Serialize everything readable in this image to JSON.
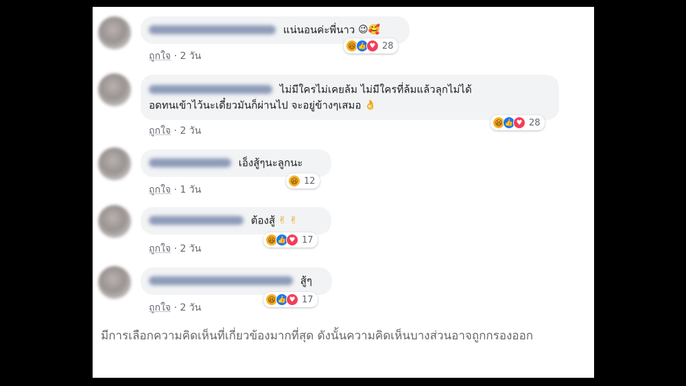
{
  "comments": [
    {
      "text": "แน่นอนค่ะพี่นาว",
      "emoji": "😉🥰",
      "like_label": "ถูกใจ",
      "dot": "·",
      "time": "2 วัน",
      "count": "28"
    },
    {
      "text": "ไม่มีใครไม่เคยล้ม ไม่มีใครที่ล้มแล้วลุกไม่ได้",
      "text2": "อดทนเข้าไว้นะเดี๋ยวมันก็ผ่านไป จะอยู่ข้างๆเสมอ",
      "emoji": "👌",
      "like_label": "ถูกใจ",
      "dot": "·",
      "time": "2 วัน",
      "count": "28"
    },
    {
      "text": "เอ็งสู้ๆนะลูกนะ",
      "like_label": "ถูกใจ",
      "dot": "·",
      "time": "1 วัน",
      "count": "12"
    },
    {
      "text": "ต้องสู้",
      "emoji": "✌ ✌",
      "like_label": "ถูกใจ",
      "dot": "·",
      "time": "2 วัน",
      "count": "17"
    },
    {
      "text": "สู้ๆ",
      "like_label": "ถูกใจ",
      "dot": "·",
      "time": "2 วัน",
      "count": "17"
    }
  ],
  "footer_note": "มีการเลือกความคิดเห็นที่เกี่ยวข้องมากที่สุด ดังนั้นความคิดเห็นบางส่วนอาจถูกกรองออก",
  "colors": {
    "haha": "#f7b125",
    "like": "#1877f2",
    "love": "#f33e58",
    "bubble": "#f2f3f5"
  },
  "icons": {
    "haha": "haha-reaction-icon",
    "like": "like-reaction-icon",
    "love": "love-reaction-icon"
  }
}
